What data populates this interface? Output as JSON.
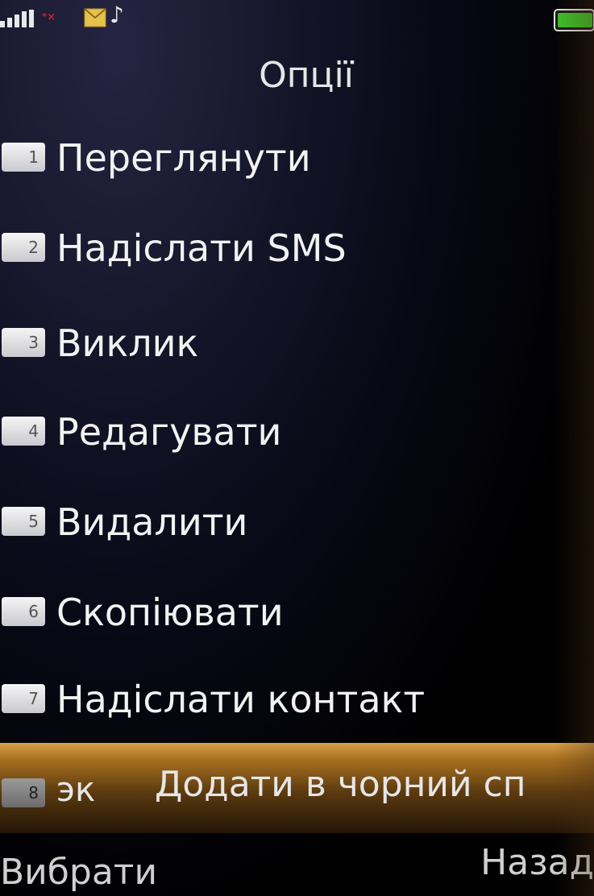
{
  "status_bar": {
    "signal_icon": "signal-bars",
    "no_signal_icon": "sim-no-signal",
    "message_icon": "envelope",
    "music_icon": "music-note",
    "battery_icon": "battery-full",
    "battery_color": "#3cbf2a"
  },
  "title": "Опції",
  "menu": {
    "items": [
      {
        "number": "1",
        "label": "Переглянути"
      },
      {
        "number": "2",
        "label": "Надіслати SMS"
      },
      {
        "number": "3",
        "label": "Виклик"
      },
      {
        "number": "4",
        "label": "Редагувати"
      },
      {
        "number": "5",
        "label": "Видалити"
      },
      {
        "number": "6",
        "label": "Скопіювати"
      },
      {
        "number": "7",
        "label": "Надіслати контакт"
      }
    ],
    "selected": {
      "number": "8",
      "prefix": "эк",
      "label": "Додати в чорний сп"
    },
    "highlight_color": "#c48a35"
  },
  "softkeys": {
    "left": "Вибрати",
    "right": "Назад"
  }
}
